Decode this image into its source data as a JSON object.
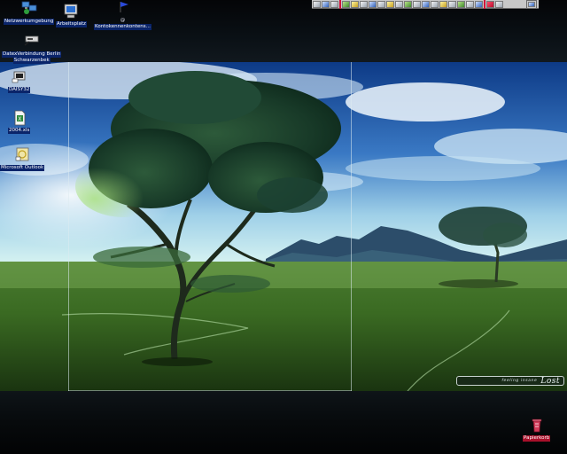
{
  "desktop": {
    "icons": [
      {
        "label": "Netzwerkumgebung",
        "icon": "network-neighborhood-icon"
      },
      {
        "label": "Arbeitsplatz",
        "icon": "my-computer-icon"
      },
      {
        "label": "@",
        "label2": "Kontokennenkontens...",
        "icon": "flag-shortcut-icon"
      },
      {
        "label": "DatexVerbindung Berlin",
        "label2": "Schwarzenbek",
        "icon": "dialup-connection-icon"
      },
      {
        "label": "DAISY32",
        "icon": "program-icon"
      },
      {
        "label": "2004.xls",
        "icon": "excel-file-icon"
      },
      {
        "label": "Microsoft Outlook",
        "icon": "outlook-icon"
      },
      {
        "label": "Papierkorb",
        "icon": "recycle-bin-icon"
      }
    ]
  },
  "wallpaper": {
    "logo_small": "feeling insane",
    "logo_big": "Lost"
  },
  "colors": {
    "selection_blue": "#0a246a",
    "recycle_red": "#a8102a",
    "toolbar_gray": "#c8c8c8"
  }
}
